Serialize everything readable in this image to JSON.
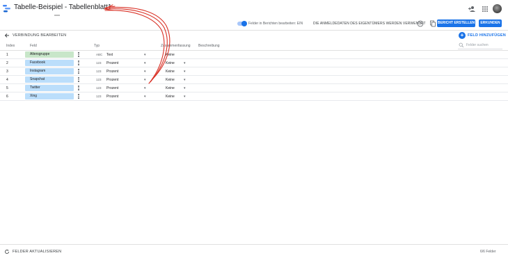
{
  "header": {
    "title": "Tabelle-Beispiel - Tabellenblatt1"
  },
  "subbar": {
    "toggle_label": "Felder in Berichten bearbeiten: EIN",
    "credentials": "DIE ANMELDEDATEN DES EIGENTÜMERS WERDEN VERWENDET",
    "create_report": "BERICHT ERSTELLEN",
    "explore": "ERKUNDEN"
  },
  "toolbar": {
    "edit_connection": "VERBINDUNG BEARBEITEN",
    "add_field": "FELD HINZUFÜGEN",
    "search_placeholder": "Felder suchen"
  },
  "columns": {
    "index": "Index",
    "field": "Feld",
    "type": "Typ",
    "aggregation": "Zusammenfassung",
    "description": "Beschreibung"
  },
  "rows": [
    {
      "index": "1",
      "field": "Altersgruppe",
      "kind": "dimension",
      "type_code": "ABC",
      "type": "Text",
      "aggregation": "Keine",
      "has_agg_dropdown": false
    },
    {
      "index": "2",
      "field": "Facebook",
      "kind": "metric",
      "type_code": "123",
      "type": "Prozent",
      "aggregation": "Keine",
      "has_agg_dropdown": true
    },
    {
      "index": "3",
      "field": "Instagram",
      "kind": "metric",
      "type_code": "123",
      "type": "Prozent",
      "aggregation": "Keine",
      "has_agg_dropdown": true
    },
    {
      "index": "4",
      "field": "Snapchat",
      "kind": "metric",
      "type_code": "123",
      "type": "Prozent",
      "aggregation": "Keine",
      "has_agg_dropdown": true
    },
    {
      "index": "5",
      "field": "Twitter",
      "kind": "metric",
      "type_code": "123",
      "type": "Prozent",
      "aggregation": "Keine",
      "has_agg_dropdown": true
    },
    {
      "index": "6",
      "field": "Xing",
      "kind": "metric",
      "type_code": "123",
      "type": "Prozent",
      "aggregation": "Keine",
      "has_agg_dropdown": true
    }
  ],
  "footer": {
    "refresh": "FELDER AKTUALISIEREN",
    "field_count": "6/6 Felder"
  },
  "colors": {
    "accent": "#1a73e8",
    "dimension_chip": "#c8e6c9",
    "metric_chip": "#bbdefb",
    "annotation_arrow": "#d93025"
  },
  "icons": [
    "logo-icon",
    "person-add-icon",
    "apps-icon",
    "avatar",
    "help-icon",
    "copy-icon",
    "back-arrow-icon",
    "add-icon",
    "search-icon",
    "more-vert-icon",
    "dropdown-arrow-icon",
    "refresh-icon"
  ]
}
